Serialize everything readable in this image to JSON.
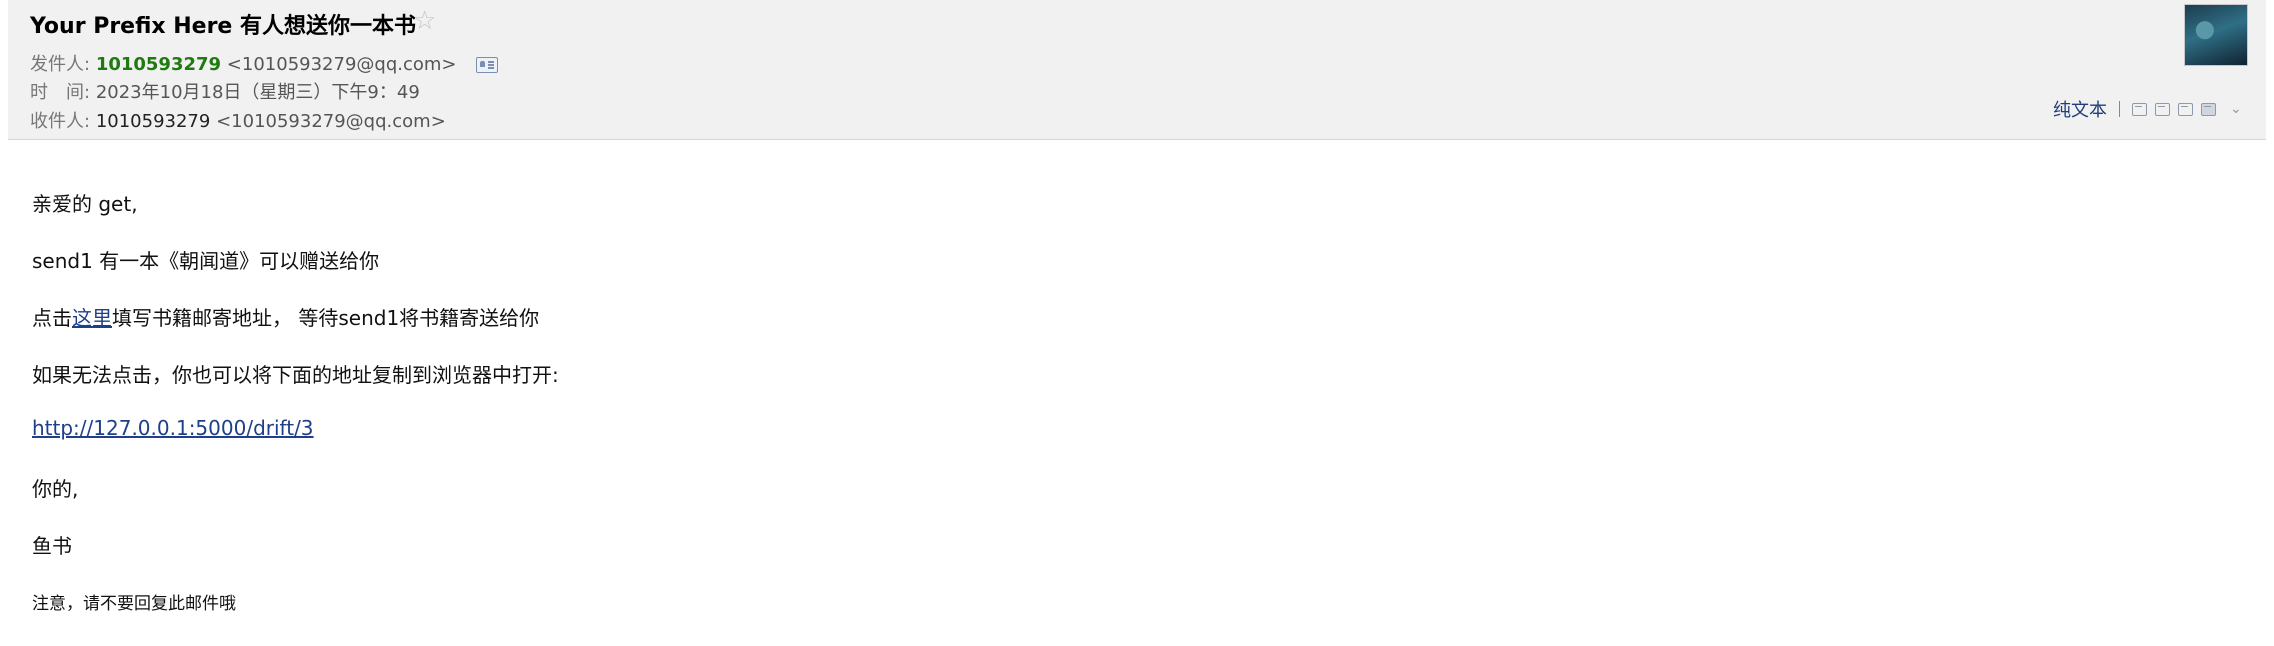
{
  "email": {
    "subject": "Your Prefix Here 有人想送你一本书",
    "star_icon": "star-outline-icon",
    "from_label": "发件人:",
    "from_name": "1010593279",
    "from_addr": "<1010593279@qq.com>",
    "time_label": "时　间:",
    "time_value": "2023年10月18日（星期三）下午9：49",
    "to_label": "收件人:",
    "to_name": "1010593279",
    "to_addr": "<1010593279@qq.com>",
    "contact_card_icon": "contact-card-icon"
  },
  "toolbar": {
    "plain_text": "纯文本",
    "icons": [
      "new-window-icon",
      "open-window-icon",
      "download-icon",
      "print-icon",
      "chevron-down-icon"
    ]
  },
  "body": {
    "greeting": "亲爱的 get,",
    "line1": "send1 有一本《朝闻道》可以赠送给你",
    "line2_pre": "点击",
    "line2_link": "这里",
    "line2_post": "填写书籍邮寄地址，  等待send1将书籍寄送给你",
    "line3": "如果无法点击，你也可以将下面的地址复制到浏览器中打开:",
    "url": "http://127.0.0.1:5000/drift/3",
    "closing": "你的,",
    "signature": "鱼书",
    "note": "注意，请不要回复此邮件哦"
  },
  "colors": {
    "header_bg": "#f1f1f1",
    "sender_name": "#1f7a0f",
    "link": "#1e3f8a"
  }
}
